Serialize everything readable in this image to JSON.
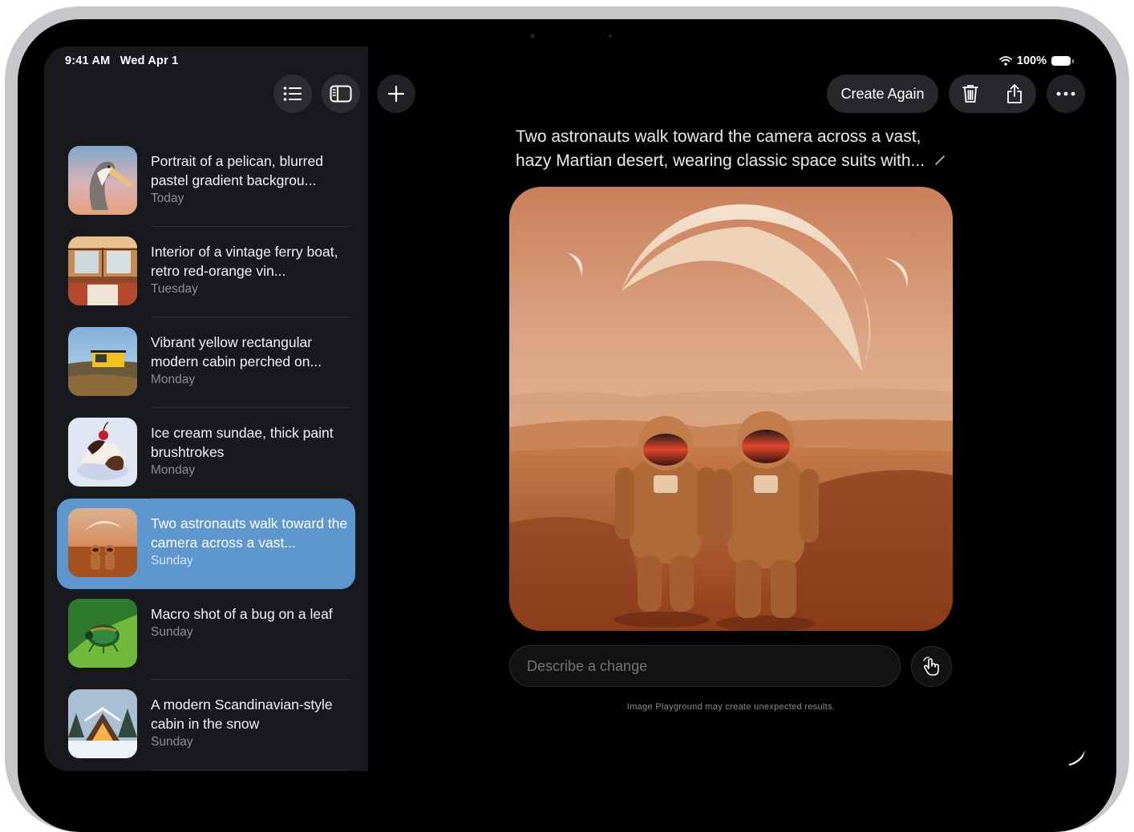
{
  "status_bar": {
    "time": "9:41 AM",
    "date": "Wed Apr 1",
    "battery": "100%"
  },
  "toolbar": {
    "list_icon": "list-bullet-icon",
    "sidebar_icon": "sidebar-toggle-icon",
    "new_icon": "plus-icon",
    "create_again_label": "Create Again",
    "delete_icon": "trash-icon",
    "share_icon": "share-icon",
    "more_icon": "ellipsis-icon"
  },
  "sidebar": {
    "items": [
      {
        "title": "Portrait of a pelican, blurred pastel gradient backgrou...",
        "date": "Today"
      },
      {
        "title": "Interior of a vintage ferry boat, retro red-orange vin...",
        "date": "Tuesday"
      },
      {
        "title": "Vibrant yellow rectangular modern cabin perched on...",
        "date": "Monday"
      },
      {
        "title": "Ice cream sundae, thick paint brushtrokes",
        "date": "Monday"
      },
      {
        "title": "Two astronauts walk toward the camera across a vast...",
        "date": "Sunday",
        "selected": true
      },
      {
        "title": "Macro shot of a bug on a leaf",
        "date": "Sunday"
      },
      {
        "title": "A modern Scandinavian-style cabin in the snow",
        "date": "Sunday"
      }
    ]
  },
  "main": {
    "prompt": "Two astronauts walk toward the camera across a vast, hazy Martian desert, wearing classic space suits with...",
    "describe_placeholder": "Describe a change",
    "disclaimer": "Image Playground may create unexpected results."
  },
  "colors": {
    "accent": "#5d97cd",
    "sidebar_bg": "#17191c",
    "screen_bg": "#000000"
  }
}
